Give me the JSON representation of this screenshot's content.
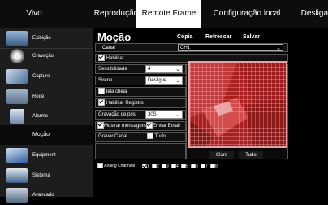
{
  "nav": {
    "tabs": [
      "Vivo",
      "Reprodução",
      "Remote Frame",
      "Configuração local",
      "Desligar"
    ],
    "active": "Remote Frame"
  },
  "sidebar": {
    "items": [
      {
        "label": "Exibição",
        "icon": "monitor-icon"
      },
      {
        "label": "Gravação",
        "icon": "film-reel-icon"
      },
      {
        "label": "Capture",
        "icon": "camera-capture-icon"
      },
      {
        "label": "Rede",
        "icon": "network-icon"
      },
      {
        "label": "Alarmo",
        "icon": "alarm-icon"
      },
      {
        "label": "Moção",
        "icon": "",
        "active": true
      },
      {
        "label": "Equipment",
        "icon": "hard-drive-icon"
      },
      {
        "label": "Sistema",
        "icon": "system-icon"
      },
      {
        "label": "Avançado",
        "icon": "advanced-icon"
      }
    ]
  },
  "page": {
    "title": "Moção",
    "actions": {
      "copy": "Cópia",
      "refresh": "Refrescar",
      "save": "Salvar"
    }
  },
  "form": {
    "channel_label": "Canal",
    "channel_value": "CH1",
    "enable_label": "Habilitar",
    "sensitivity_label": "Sensibilidade",
    "sensitivity_value": "4",
    "siren_label": "Sirene",
    "siren_value": "Desligue",
    "fullscreen_label": "tela cheia",
    "enable_record_label": "Habilitar Registro",
    "post_record_label": "Gravação de pós",
    "post_record_value": "30S",
    "show_message_label": "Mostrar mensagem",
    "send_email_label": "Enviar Email",
    "record_channel_label": "Gravar Canal",
    "all_label": "Tudo"
  },
  "motion_area": {
    "clear_label": "Claro",
    "all_label": "Tudo"
  },
  "analog": {
    "label": "Analog Channels",
    "channels": [
      "1",
      "2",
      "3",
      "4",
      "5",
      "6",
      "7",
      "8"
    ]
  }
}
